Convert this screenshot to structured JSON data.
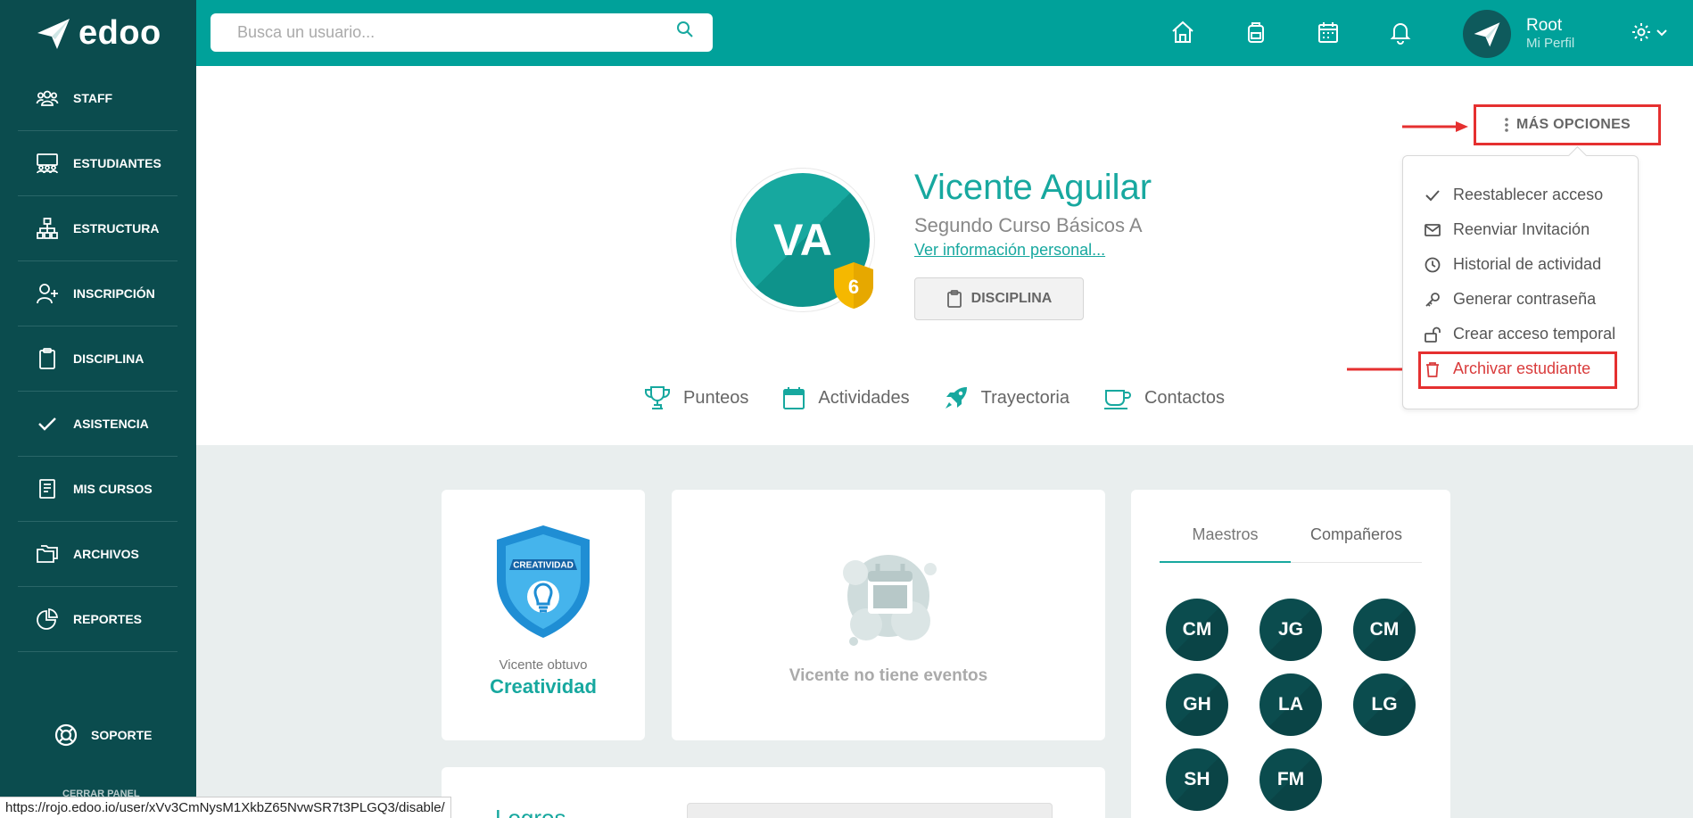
{
  "app": {
    "logo_text": "edoo"
  },
  "search": {
    "placeholder": "Busca un usuario..."
  },
  "user": {
    "name": "Root",
    "subtitle": "Mi Perfil"
  },
  "sidebar": {
    "items": [
      {
        "label": "STAFF",
        "icon": "users-icon"
      },
      {
        "label": "ESTUDIANTES",
        "icon": "students-icon"
      },
      {
        "label": "ESTRUCTURA",
        "icon": "sitemap-icon"
      },
      {
        "label": "INSCRIPCIÓN",
        "icon": "user-plus-icon"
      },
      {
        "label": "DISCIPLINA",
        "icon": "clipboard-icon"
      },
      {
        "label": "ASISTENCIA",
        "icon": "check-icon"
      },
      {
        "label": "MIS CURSOS",
        "icon": "book-icon"
      },
      {
        "label": "ARCHIVOS",
        "icon": "folders-icon"
      },
      {
        "label": "REPORTES",
        "icon": "pie-chart-icon"
      }
    ],
    "support_label": "SOPORTE",
    "logout_label": "CERRAR PANEL"
  },
  "profile": {
    "initials": "VA",
    "badge_count": "6",
    "name": "Vicente Aguilar",
    "course": "Segundo Curso Básicos A",
    "info_link": "Ver información personal...",
    "discipline_button": "DISCIPLINA",
    "more_options": "MÁS OPCIONES",
    "tabs": [
      {
        "label": "Punteos"
      },
      {
        "label": "Actividades"
      },
      {
        "label": "Trayectoria"
      },
      {
        "label": "Contactos"
      }
    ]
  },
  "dropdown": {
    "items": [
      {
        "label": "Reestablecer acceso"
      },
      {
        "label": "Reenviar Invitación"
      },
      {
        "label": "Historial de actividad"
      },
      {
        "label": "Generar contraseña"
      },
      {
        "label": "Crear acceso temporal"
      },
      {
        "label": "Archivar estudiante"
      }
    ]
  },
  "achievement": {
    "shield_text": "CREATIVIDAD",
    "caption": "Vicente obtuvo",
    "name": "Creatividad"
  },
  "events": {
    "empty_text": "Vicente no tiene eventos"
  },
  "peers": {
    "tabs": [
      "Maestros",
      "Compañeros"
    ],
    "people": [
      "CM",
      "JG",
      "CM",
      "GH",
      "LA",
      "LG",
      "SH",
      "FM"
    ]
  },
  "logros": {
    "title": "Logros"
  },
  "status_bar": {
    "url": "https://rojo.edoo.io/user/xVv3CmNysM1XkbZ65NvwSR7t3PLGQ3/disable/"
  },
  "colors": {
    "teal": "#00a19a",
    "dark_teal": "#0b4c4e",
    "accent_text": "#17a89f",
    "danger": "#d93b3b",
    "highlight": "#e53030"
  }
}
